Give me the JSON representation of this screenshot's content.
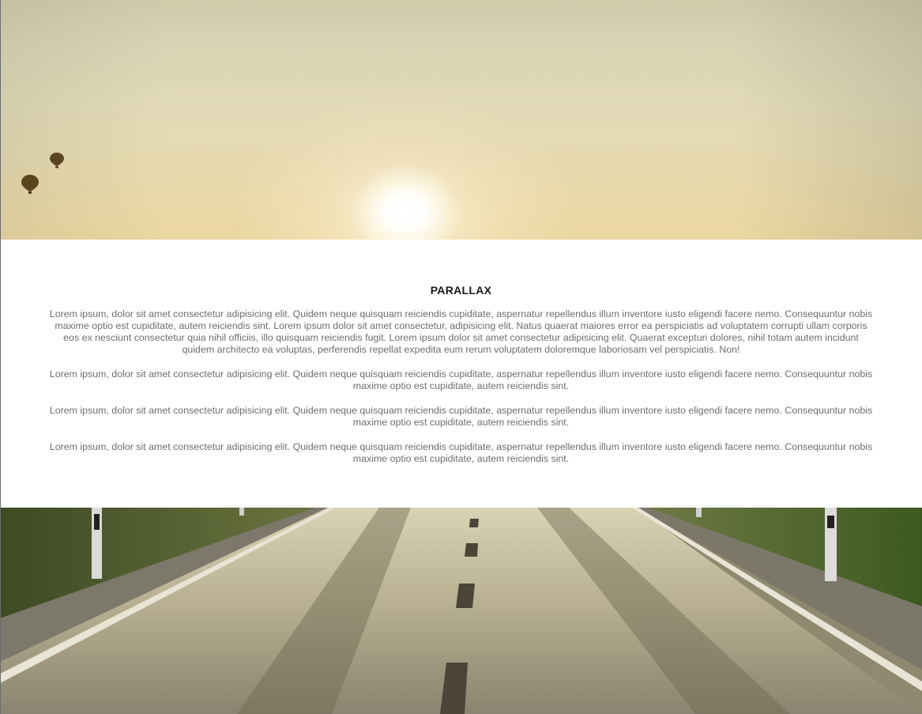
{
  "section": {
    "title": "PARALLAX",
    "paragraphs": [
      "Lorem ipsum, dolor sit amet consectetur adipisicing elit. Quidem neque quisquam reiciendis cupiditate, aspernatur repellendus illum inventore iusto eligendi facere nemo. Consequuntur nobis maxime optio est cupiditate, autem reiciendis sint. Lorem ipsum dolor sit amet consectetur, adipisicing elit. Natus quaerat maiores error ea perspiciatis ad voluptatem corrupti ullam corporis eos ex nesciunt consectetur quia nihil officiis, illo quisquam reiciendis fugit. Lorem ipsum dolor sit amet consectetur adipisicing elit. Quaerat excepturi dolores, nihil totam autem incidunt quidem architecto ea voluptas, perferendis repellat expedita eum rerum voluptatem doloremque laboriosam vel perspiciatis. Non!",
      "Lorem ipsum, dolor sit amet consectetur adipisicing elit. Quidem neque quisquam reiciendis cupiditate, aspernatur repellendus illum inventore iusto eligendi facere nemo. Consequuntur nobis maxime optio est cupiditate, autem reiciendis sint.",
      "Lorem ipsum, dolor sit amet consectetur adipisicing elit. Quidem neque quisquam reiciendis cupiditate, aspernatur repellendus illum inventore iusto eligendi facere nemo. Consequuntur nobis maxime optio est cupiditate, autem reiciendis sint.",
      "Lorem ipsum, dolor sit amet consectetur adipisicing elit. Quidem neque quisquam reiciendis cupiditate, aspernatur repellendus illum inventore iusto eligendi facere nemo. Consequuntur nobis maxime optio est cupiditate, autem reiciendis sint."
    ]
  },
  "images": {
    "hero": "sunset-sky-with-hot-air-balloons",
    "footer": "empty-highway-road"
  },
  "colors": {
    "title": "#1a1a1a",
    "body_text": "#6d6d6d",
    "background": "#ffffff"
  }
}
